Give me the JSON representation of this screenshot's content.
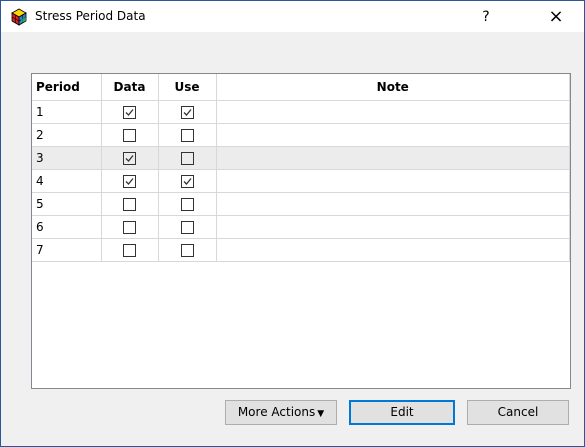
{
  "window": {
    "title": "Stress Period Data"
  },
  "titlebar": {
    "help_label": "?",
    "close_label": "×"
  },
  "table": {
    "columns": [
      "Period",
      "Data",
      "Use",
      "Note"
    ],
    "rows": [
      {
        "period": "1",
        "data": true,
        "use": true,
        "note": ""
      },
      {
        "period": "2",
        "data": false,
        "use": false,
        "note": ""
      },
      {
        "period": "3",
        "data": true,
        "use": false,
        "note": ""
      },
      {
        "period": "4",
        "data": true,
        "use": true,
        "note": ""
      },
      {
        "period": "5",
        "data": false,
        "use": false,
        "note": ""
      },
      {
        "period": "6",
        "data": false,
        "use": false,
        "note": ""
      },
      {
        "period": "7",
        "data": false,
        "use": false,
        "note": ""
      }
    ],
    "highlighted_row": 2
  },
  "buttons": {
    "more_actions": "More Actions",
    "edit": "Edit",
    "cancel": "Cancel"
  },
  "icons": {
    "app": "cube-icon",
    "dropdown": "caret-down-icon"
  }
}
